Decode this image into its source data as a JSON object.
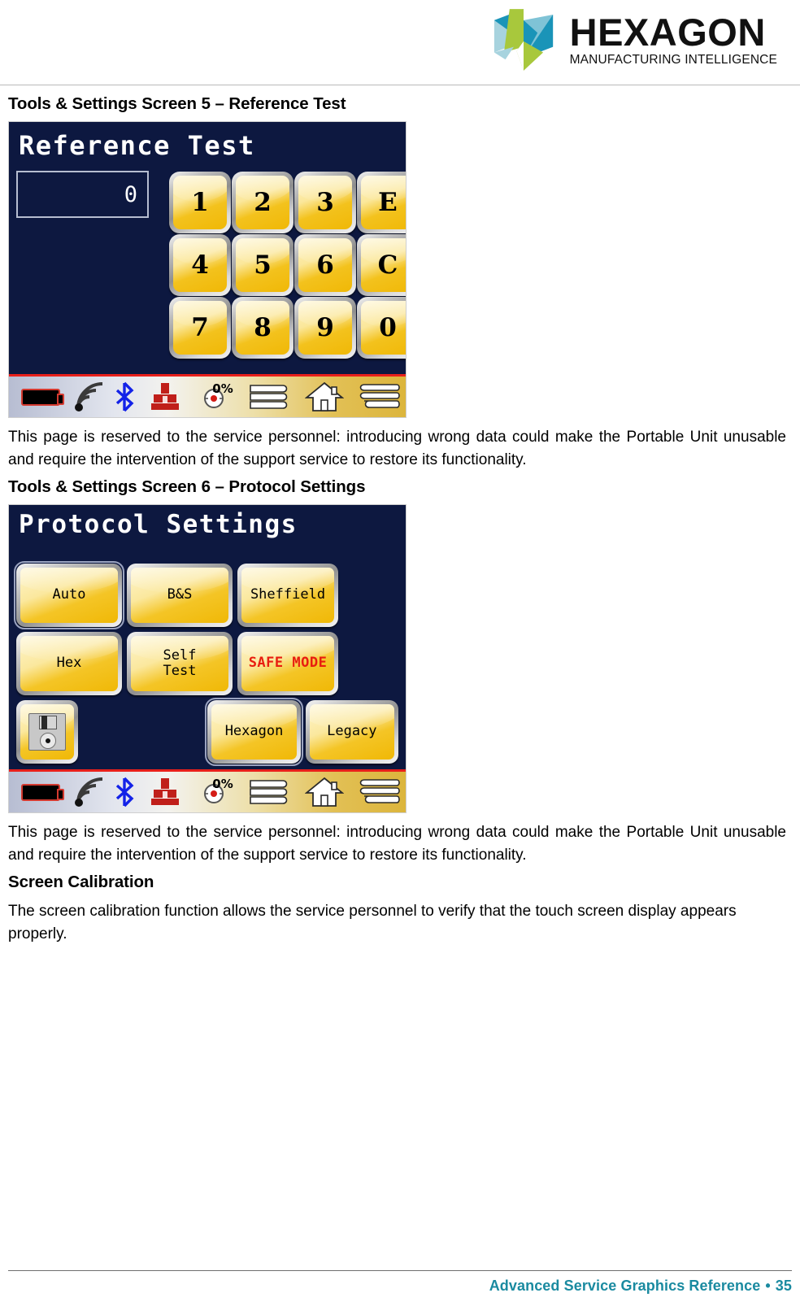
{
  "header": {
    "logo_name": "HEXAGON",
    "logo_tagline": "MANUFACTURING INTELLIGENCE",
    "logo_colors": {
      "teal": "#1a94b8",
      "green": "#a8c83c",
      "light_blue": "#a7d3de",
      "mid_blue": "#7fc3d6"
    }
  },
  "sections": [
    {
      "heading": "Tools & Settings Screen 5 – Reference Test",
      "paragraph": "This page is reserved to the service personnel: introducing wrong data could make the Portable Unit unusable and require the intervention of the support service to restore its functionality."
    },
    {
      "heading": "Tools & Settings Screen 6 – Protocol Settings",
      "paragraph": "This page is reserved to the service personnel: introducing wrong data could make the Portable Unit unusable and require the intervention of the support service to restore its functionality."
    },
    {
      "heading": "Screen Calibration",
      "paragraph": "The screen calibration function allows the service personnel to verify that the touch screen display appears properly."
    }
  ],
  "device_screen_reference_test": {
    "title": "Reference Test",
    "display_value": "0",
    "keys": [
      "1",
      "2",
      "3",
      "E",
      "4",
      "5",
      "6",
      "C",
      "7",
      "8",
      "9",
      "0"
    ],
    "statusbar": {
      "battery_label": "battery-icon",
      "signal_label": "wireless-signal-icon",
      "bluetooth_label": "bluetooth-icon",
      "probe_label": "probe-icon",
      "gauge_value": "0",
      "gauge_unit": "%",
      "list_label": "list-icon",
      "home_label": "home-icon",
      "menu_label": "menu-icon"
    }
  },
  "device_screen_protocol_settings": {
    "title": "Protocol Settings",
    "rows": [
      [
        {
          "label": "Auto",
          "selected": true,
          "style": "normal"
        },
        {
          "label": "B&S",
          "selected": false,
          "style": "normal"
        },
        {
          "label": "Sheffield",
          "selected": false,
          "style": "normal"
        }
      ],
      [
        {
          "label": "Hex",
          "selected": false,
          "style": "normal"
        },
        {
          "label": "Self\nTest",
          "selected": false,
          "style": "normal"
        },
        {
          "label": "SAFE MODE",
          "selected": false,
          "style": "danger"
        }
      ],
      [
        {
          "label": "Hexagon",
          "selected": true,
          "style": "normal"
        },
        {
          "label": "Legacy",
          "selected": false,
          "style": "normal"
        }
      ]
    ],
    "save_button": "save-floppy-icon",
    "statusbar": {
      "battery_label": "battery-icon",
      "signal_label": "wireless-signal-icon",
      "bluetooth_label": "bluetooth-icon",
      "probe_label": "probe-icon",
      "gauge_value": "0",
      "gauge_unit": "%",
      "list_label": "list-icon",
      "home_label": "home-icon",
      "menu_label": "menu-icon"
    }
  },
  "footer": {
    "title": "Advanced Service Graphics Reference",
    "separator": "•",
    "page_number": "35",
    "color": "#1a8aa0"
  }
}
